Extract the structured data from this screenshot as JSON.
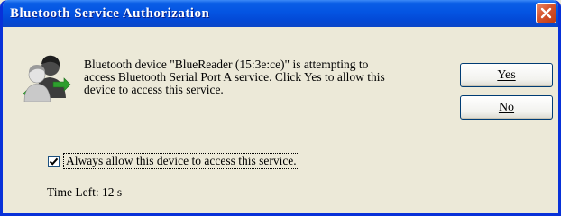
{
  "window": {
    "title": "Bluetooth Service Authorization",
    "close_icon": "close-icon",
    "colors": {
      "titlebar": "#0454e2",
      "close": "#d6542d",
      "dialog_bg": "#ece9d8"
    }
  },
  "message": {
    "icon": "bluetooth-users-icon",
    "lines": [
      "Bluetooth device \"BlueReader (15:3e:ce)\" is attempting to",
      "access Bluetooth Serial Port A service. Click Yes to allow this",
      "device to access this service."
    ]
  },
  "buttons": {
    "yes": {
      "label": "Yes",
      "accesskey": "Y"
    },
    "no": {
      "label": "No",
      "accesskey": "N"
    }
  },
  "always_allow": {
    "checked": true,
    "label": "Always allow this device to access this service."
  },
  "time_left": "Time Left: 12 s"
}
